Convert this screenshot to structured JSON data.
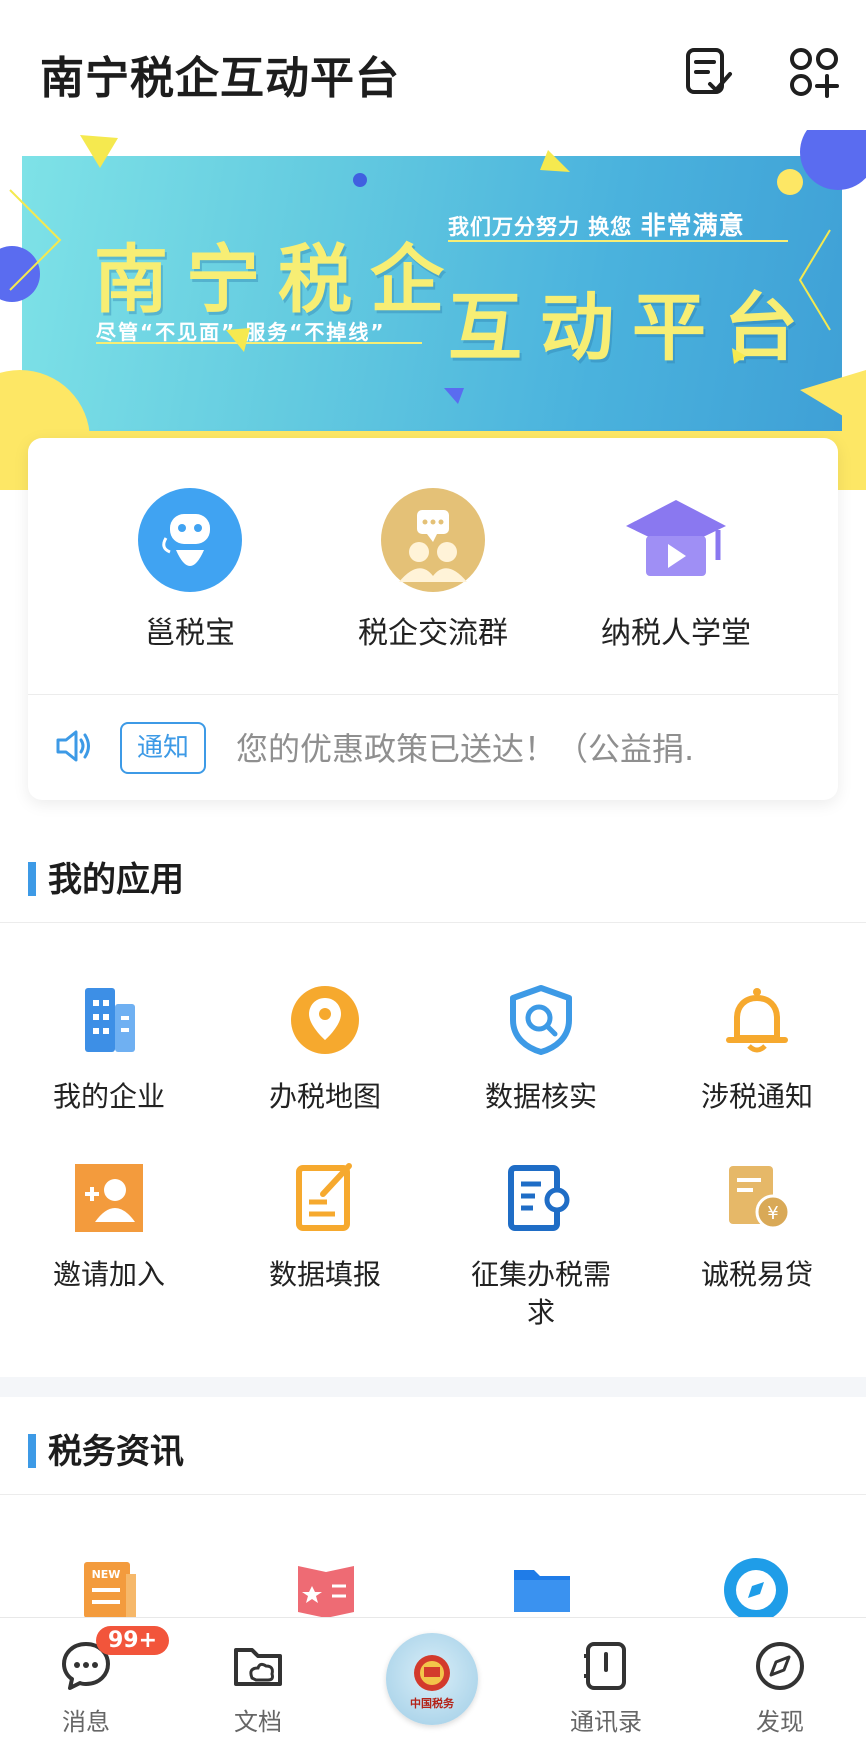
{
  "header": {
    "title": "南宁税企互动平台",
    "icons": [
      "checklist-icon",
      "apps-add-icon"
    ]
  },
  "banner": {
    "title_left": "南宁税企",
    "title_right": "互动平台",
    "slogan_left": "尽管“不见面” 服务“不掉线”",
    "slogan_right_a": "我们万分努力 换您",
    "slogan_right_b": "非常满意"
  },
  "quick": {
    "items": [
      {
        "label": "邕税宝",
        "icon": "robot-icon"
      },
      {
        "label": "税企交流群",
        "icon": "chat-group-icon"
      },
      {
        "label": "纳税人学堂",
        "icon": "graduation-cap-icon"
      }
    ],
    "notice": {
      "badge": "通知",
      "text": "您的优惠政策已送达！（公益捐."
    }
  },
  "my_apps": {
    "title": "我的应用",
    "items": [
      {
        "label": "我的企业",
        "icon": "building-icon"
      },
      {
        "label": "办税地图",
        "icon": "map-pin-icon"
      },
      {
        "label": "数据核实",
        "icon": "shield-search-icon"
      },
      {
        "label": "涉税通知",
        "icon": "bell-icon"
      },
      {
        "label": "邀请加入",
        "icon": "add-user-icon"
      },
      {
        "label": "数据填报",
        "icon": "edit-form-icon"
      },
      {
        "label": "征集办税需\n求",
        "icon": "document-search-icon"
      },
      {
        "label": "诚税易贷",
        "icon": "loan-icon"
      }
    ]
  },
  "tax_news": {
    "title": "税务资讯",
    "icons": [
      "news-icon",
      "policy-book-icon",
      "folder-icon",
      "compass-icon"
    ]
  },
  "bottom_nav": {
    "items": [
      {
        "label": "消息",
        "icon": "message-icon",
        "badge": "99+"
      },
      {
        "label": "文档",
        "icon": "document-folder-icon"
      },
      {
        "label": "",
        "icon": "tax-emblem-icon"
      },
      {
        "label": "通讯录",
        "icon": "contacts-icon"
      },
      {
        "label": "发现",
        "icon": "discover-icon"
      }
    ]
  },
  "colors": {
    "accent": "#3d9ae6",
    "banner_yellow": "#f7ee74",
    "badge_red": "#f2553b"
  }
}
